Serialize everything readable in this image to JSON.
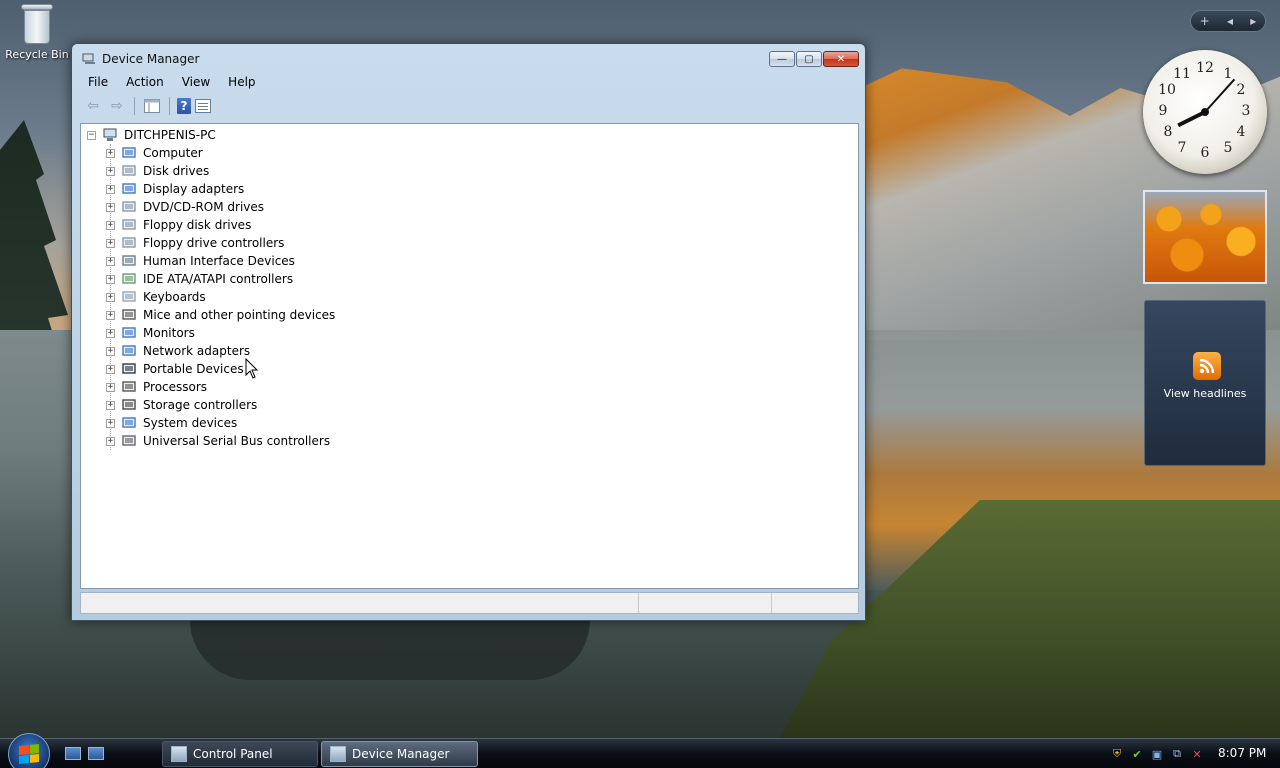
{
  "desktop": {
    "recycle_bin_label": "Recycle Bin"
  },
  "window": {
    "title": "Device Manager",
    "controls": {
      "minimize": "—",
      "maximize": "▢",
      "close": "✕"
    },
    "menu": [
      "File",
      "Action",
      "View",
      "Help"
    ],
    "toolbar": {
      "help_label": "?"
    },
    "tree": {
      "root": "DITCHPENIS-PC",
      "items": [
        {
          "label": "Computer",
          "icon": "computer-icon"
        },
        {
          "label": "Disk drives",
          "icon": "disk-drive-icon"
        },
        {
          "label": "Display adapters",
          "icon": "display-adapter-icon"
        },
        {
          "label": "DVD/CD-ROM drives",
          "icon": "dvd-drive-icon"
        },
        {
          "label": "Floppy disk drives",
          "icon": "floppy-disk-icon"
        },
        {
          "label": "Floppy drive controllers",
          "icon": "floppy-controller-icon"
        },
        {
          "label": "Human Interface Devices",
          "icon": "hid-icon"
        },
        {
          "label": "IDE ATA/ATAPI controllers",
          "icon": "ide-controller-icon"
        },
        {
          "label": "Keyboards",
          "icon": "keyboard-icon"
        },
        {
          "label": "Mice and other pointing devices",
          "icon": "mouse-icon"
        },
        {
          "label": "Monitors",
          "icon": "monitor-icon"
        },
        {
          "label": "Network adapters",
          "icon": "network-adapter-icon"
        },
        {
          "label": "Portable Devices",
          "icon": "portable-device-icon"
        },
        {
          "label": "Processors",
          "icon": "processor-icon"
        },
        {
          "label": "Storage controllers",
          "icon": "storage-controller-icon"
        },
        {
          "label": "System devices",
          "icon": "system-device-icon"
        },
        {
          "label": "Universal Serial Bus controllers",
          "icon": "usb-icon"
        }
      ]
    }
  },
  "gadgets": {
    "sidebar_controls": {
      "add": "+",
      "prev": "◂",
      "next": "▸"
    },
    "clock": {
      "hour": 8,
      "minute": 7
    },
    "feed_label": "View headlines"
  },
  "taskbar": {
    "buttons": [
      {
        "label": "Control Panel",
        "active": false
      },
      {
        "label": "Device Manager",
        "active": true
      }
    ],
    "time": "8:07 PM"
  }
}
